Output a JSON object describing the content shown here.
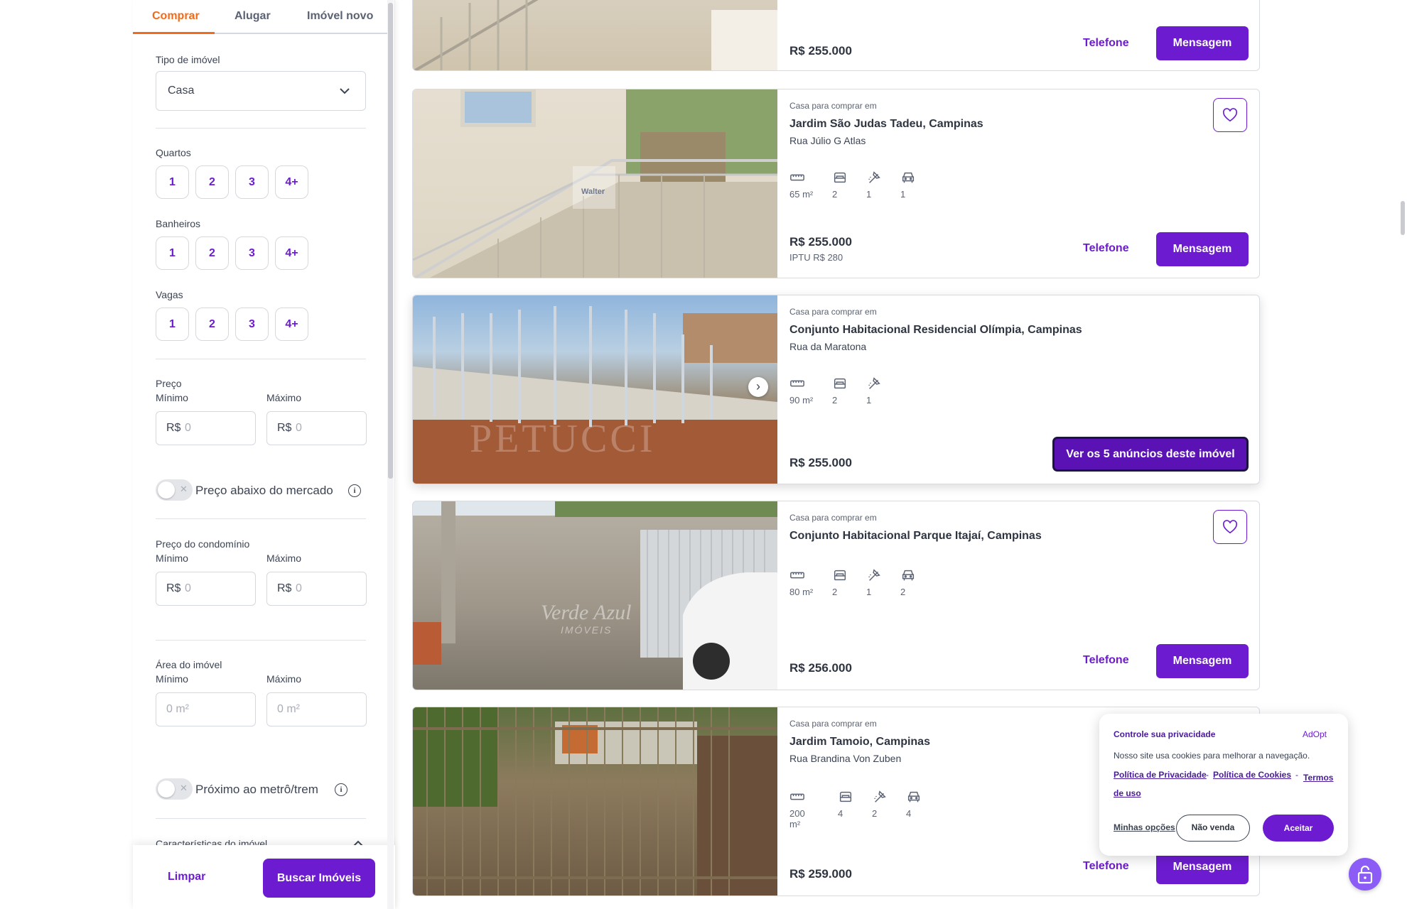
{
  "tabs": {
    "buy": "Comprar",
    "rent": "Alugar",
    "new": "Imóvel novo"
  },
  "filters": {
    "type_label": "Tipo de imóvel",
    "type_value": "Casa",
    "rooms_label": "Quartos",
    "baths_label": "Banheiros",
    "parking_label": "Vagas",
    "counts": [
      "1",
      "2",
      "3",
      "4+"
    ],
    "price_label": "Preço",
    "min_label": "Mínimo",
    "max_label": "Máximo",
    "currency": "R$",
    "price_placeholder": "0",
    "below_market_label": "Preço abaixo do mercado",
    "condo_label": "Preço do condomínio",
    "area_label": "Área do imóvel",
    "area_placeholder": "0 m²",
    "metro_label": "Próximo ao metrô/trem",
    "features_label": "Características do imóvel",
    "clear_button": "Limpar",
    "search_button": "Buscar Imóveis",
    "below_market_on": false,
    "metro_on": false
  },
  "listings": [
    {
      "price": "R$ 255.000",
      "phone_button": "Telefone",
      "message_button": "Mensagem"
    },
    {
      "type": "Casa para comprar em",
      "title": "Jardim São Judas Tadeu, Campinas",
      "address": "Rua Júlio G Atlas",
      "area": "65 m²",
      "bedrooms": "2",
      "bathrooms": "1",
      "parking": "1",
      "price": "R$ 255.000",
      "iptu": "IPTU R$ 280",
      "phone_button": "Telefone",
      "message_button": "Mensagem",
      "watermark": "Walter"
    },
    {
      "type": "Casa para comprar em",
      "title": "Conjunto Habitacional Residencial Olímpia, Campinas",
      "address": "Rua da Maratona",
      "area": "90 m²",
      "bedrooms": "2",
      "bathrooms": "1",
      "price": "R$ 255.000",
      "cta_button": "Ver os 5 anúncios deste imóvel",
      "watermark": "PETUCCI"
    },
    {
      "type": "Casa para comprar em",
      "title": "Conjunto Habitacional Parque Itajaí, Campinas",
      "area": "80 m²",
      "bedrooms": "2",
      "bathrooms": "1",
      "parking": "2",
      "price": "R$ 256.000",
      "phone_button": "Telefone",
      "message_button": "Mensagem",
      "watermark": "Verde Azul",
      "watermark_sub": "IMÓVEIS"
    },
    {
      "type": "Casa para comprar em",
      "title": "Jardim Tamoio, Campinas",
      "address": "Rua Brandina Von Zuben",
      "area": "200 m²",
      "bedrooms": "4",
      "bathrooms": "2",
      "parking": "4",
      "price": "R$ 259.000",
      "phone_button": "Telefone",
      "message_button": "Mensagem"
    }
  ],
  "cookie": {
    "title": "Controle sua privacidade",
    "brand": "AdOpt",
    "text": "Nosso site usa cookies para melhorar a navegação.",
    "privacy_link": "Política de Privacidade",
    "sep": "-",
    "cookies_link": "Política de Cookies",
    "terms_link": "Termos de uso",
    "options_link": "Minhas opções",
    "no_sell_button": "Não venda",
    "accept_button": "Aceitar"
  },
  "colors": {
    "brand": "#6d1bd1",
    "tab_active": "#f26a1b"
  },
  "icons": [
    "chevron-down-icon",
    "ruler-icon",
    "bed-icon",
    "shower-icon",
    "car-icon",
    "heart-icon",
    "chevron-right-icon",
    "info-icon",
    "lock-icon"
  ]
}
